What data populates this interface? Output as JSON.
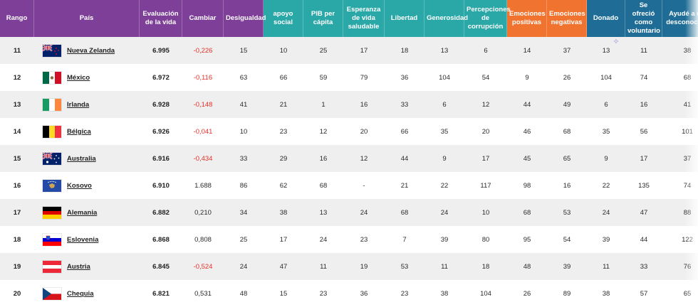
{
  "colors": {
    "purple": "#7d3f98",
    "teal": "#2aa7a7",
    "orange": "#f07430",
    "navy": "#1f6d96",
    "negative": "#e8302a"
  },
  "headers": [
    {
      "label": "Rango",
      "group": "purple"
    },
    {
      "label": "País",
      "group": "purple"
    },
    {
      "label": "Evaluación de la vida",
      "group": "purple"
    },
    {
      "label": "Cambiar",
      "group": "purple"
    },
    {
      "label": "Desigualdad",
      "group": "purple"
    },
    {
      "label": "apoyo social",
      "group": "teal"
    },
    {
      "label": "PIB per cápita",
      "group": "teal"
    },
    {
      "label": "Esperanza de vida saludable",
      "group": "teal"
    },
    {
      "label": "Libertad",
      "group": "teal"
    },
    {
      "label": "Generosidad",
      "group": "teal"
    },
    {
      "label": "Percepciones de corrupción",
      "group": "teal"
    },
    {
      "label": "Emociones positivas",
      "group": "orange"
    },
    {
      "label": "Emociones negativas",
      "group": "orange"
    },
    {
      "label": "Donado",
      "group": "navy"
    },
    {
      "label": "Se ofreció como voluntario",
      "group": "navy"
    },
    {
      "label": "Ayudé a un desconocido",
      "group": "navy"
    }
  ],
  "rows": [
    {
      "rank": "11",
      "country": "Nueva Zelanda",
      "flag": "nz",
      "life": "6.995",
      "change": "-0,226",
      "neg": true,
      "values": [
        "15",
        "10",
        "25",
        "17",
        "18",
        "13",
        "6",
        "14",
        "37",
        "13",
        "11",
        "38"
      ]
    },
    {
      "rank": "12",
      "country": "México",
      "flag": "mx",
      "life": "6.972",
      "change": "-0,116",
      "neg": true,
      "values": [
        "63",
        "66",
        "59",
        "79",
        "36",
        "104",
        "54",
        "9",
        "26",
        "104",
        "74",
        "68"
      ]
    },
    {
      "rank": "13",
      "country": "Irlanda",
      "flag": "ie",
      "life": "6.928",
      "change": "-0,148",
      "neg": true,
      "values": [
        "41",
        "21",
        "1",
        "16",
        "33",
        "6",
        "12",
        "44",
        "49",
        "6",
        "16",
        "41"
      ]
    },
    {
      "rank": "14",
      "country": "Bélgica",
      "flag": "be",
      "life": "6.926",
      "change": "-0,041",
      "neg": true,
      "values": [
        "10",
        "23",
        "12",
        "20",
        "66",
        "35",
        "20",
        "46",
        "68",
        "35",
        "56",
        "101"
      ]
    },
    {
      "rank": "15",
      "country": "Australia",
      "flag": "au",
      "life": "6.916",
      "change": "-0,434",
      "neg": true,
      "values": [
        "33",
        "29",
        "16",
        "12",
        "44",
        "9",
        "17",
        "45",
        "65",
        "9",
        "17",
        "37"
      ]
    },
    {
      "rank": "16",
      "country": "Kosovo",
      "flag": "xk",
      "life": "6.910",
      "change": "1.688",
      "neg": false,
      "values": [
        "86",
        "62",
        "68",
        "-",
        "21",
        "22",
        "117",
        "98",
        "16",
        "22",
        "135",
        "74"
      ]
    },
    {
      "rank": "17",
      "country": "Alemania",
      "flag": "de",
      "life": "6.882",
      "change": "0,210",
      "neg": false,
      "values": [
        "34",
        "38",
        "13",
        "24",
        "68",
        "24",
        "10",
        "68",
        "53",
        "24",
        "47",
        "88"
      ]
    },
    {
      "rank": "18",
      "country": "Eslovenia",
      "flag": "si",
      "life": "6.868",
      "change": "0,808",
      "neg": false,
      "values": [
        "25",
        "17",
        "24",
        "23",
        "7",
        "39",
        "80",
        "95",
        "54",
        "39",
        "44",
        "122"
      ]
    },
    {
      "rank": "19",
      "country": "Austria",
      "flag": "at",
      "life": "6.845",
      "change": "-0,524",
      "neg": true,
      "values": [
        "24",
        "47",
        "11",
        "19",
        "53",
        "11",
        "18",
        "48",
        "39",
        "11",
        "33",
        "76"
      ]
    },
    {
      "rank": "20",
      "country": "Chequia",
      "flag": "cz",
      "life": "6.821",
      "change": "0,531",
      "neg": false,
      "values": [
        "48",
        "15",
        "23",
        "36",
        "23",
        "38",
        "104",
        "26",
        "89",
        "38",
        "57",
        "65"
      ]
    }
  ]
}
